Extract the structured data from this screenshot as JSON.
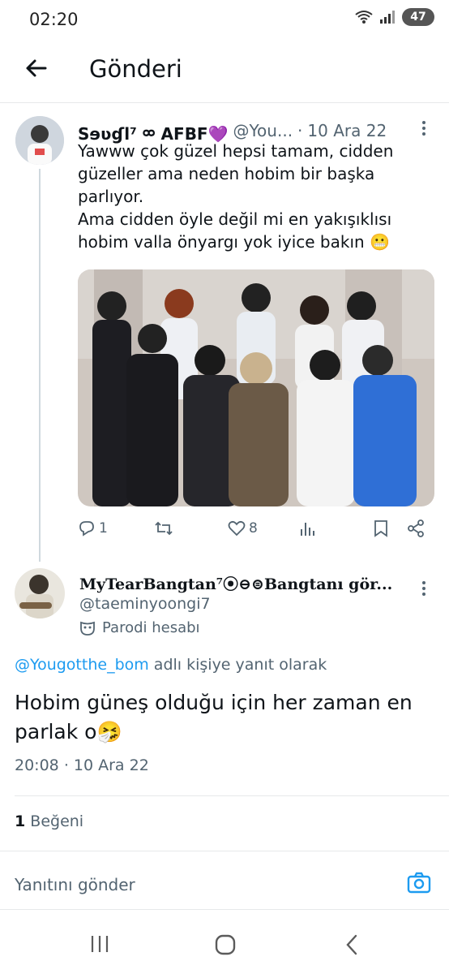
{
  "status_bar": {
    "time": "02:20",
    "battery": "47"
  },
  "header": {
    "title": "Gönderi"
  },
  "parent_tweet": {
    "display_name": "Sɘʋɠl⁷ ᢁ AFBF💜",
    "handle": "@You...",
    "separator": "·",
    "date": "10 Ara 22",
    "text_lines": [
      "Yawww çok güzel hepsi tamam, cidden",
      "güzeller ama neden hobim bir başka",
      "parlıyor.",
      "Ama cidden öyle değil mi en yakışıklısı",
      "hobim valla önyargı yok iyice bakın 😬"
    ],
    "replies_count": "1",
    "likes_count": "8"
  },
  "reply_tweet": {
    "display_name": "MyTearBangtan⁷⦿⊖⊜Bangtanı gör...",
    "handle": "@taeminyoongi7",
    "parody_label": "Parodi hesabı",
    "reply_to_mention": "@Yougotthe_bom",
    "reply_to_suffix": " adlı kişiye yanıt olarak",
    "text": "Hobim güneş olduğu için her zaman en parlak o🤧",
    "time": "20:08",
    "separator": "·",
    "date": "10 Ara 22",
    "likes_count": "1",
    "likes_label": "Beğeni"
  },
  "composer": {
    "placeholder": "Yanıtını gönder"
  },
  "colors": {
    "accent": "#1d9bf0",
    "text": "#0f1419",
    "secondary": "#536471"
  },
  "icons": [
    "back-arrow-icon",
    "more-icon",
    "reply-icon",
    "retweet-icon",
    "heart-icon",
    "views-icon",
    "bookmark-icon",
    "share-icon",
    "parody-mask-icon",
    "camera-icon",
    "recents-icon",
    "home-icon",
    "back-nav-icon"
  ]
}
